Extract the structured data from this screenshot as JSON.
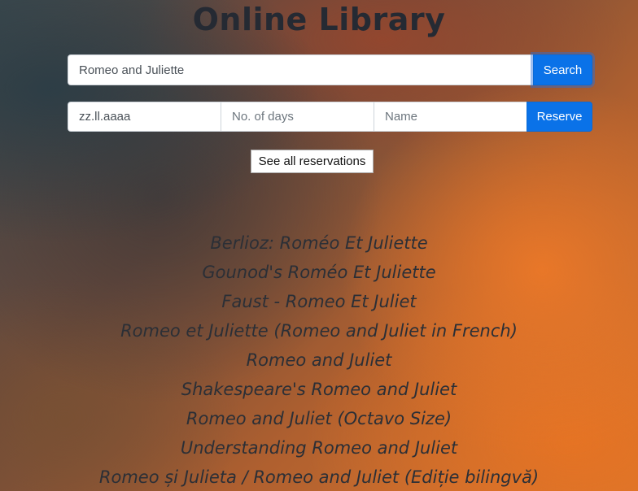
{
  "header": {
    "title": "Online Library"
  },
  "search": {
    "value": "Romeo and Juliette",
    "button_label": "Search"
  },
  "reservation": {
    "date_value": "zz.ll.aaaa",
    "days_placeholder": "No. of days",
    "name_placeholder": "Name",
    "button_label": "Reserve"
  },
  "see_all_label": "See all reservations",
  "results": [
    "Berlioz: Roméo Et Juliette",
    "Gounod's Roméo Et Juliette",
    "Faust - Romeo Et Juliet",
    "Romeo et Juliette (Romeo and Juliet in French)",
    "Romeo and Juliet",
    "Shakespeare's Romeo and Juliet",
    "Romeo and Juliet (Octavo Size)",
    "Understanding Romeo and Juliet",
    "Romeo și Julieta / Romeo and Juliet (Ediție bilingvă)"
  ],
  "colors": {
    "primary": "#0a72e8",
    "title_text": "#252a33",
    "result_text": "#2b2f36"
  }
}
